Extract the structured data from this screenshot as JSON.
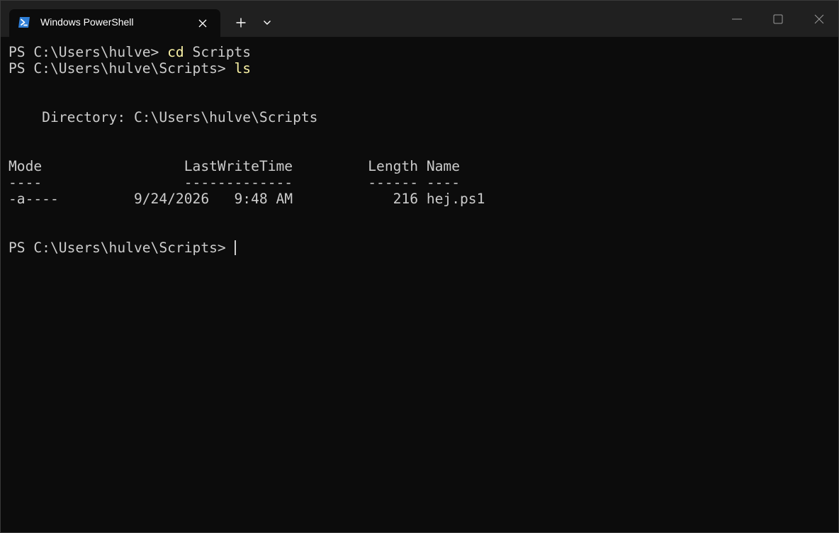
{
  "window": {
    "tab_title": "Windows PowerShell",
    "tab_icon": "powershell-icon",
    "new_tab_icon": "plus-icon",
    "dropdown_icon": "chevron-down-icon",
    "minimize_icon": "minimize-icon",
    "maximize_icon": "maximize-icon",
    "close_icon": "close-icon"
  },
  "colors": {
    "background": "#0c0c0c",
    "titlebar": "#202020",
    "text": "#cccccc",
    "command": "#f9f1a5"
  },
  "terminal": {
    "line1": {
      "prompt": "PS C:\\Users\\hulve> ",
      "command": "cd",
      "args": " Scripts"
    },
    "line2": {
      "prompt": "PS C:\\Users\\hulve\\Scripts> ",
      "command": "ls"
    },
    "directory_line": "    Directory: C:\\Users\\hulve\\Scripts",
    "header_line": "Mode                 LastWriteTime         Length Name",
    "separator_line": "----                 -------------         ------ ----",
    "rows": [
      {
        "text": "-a----         9/24/2026   9:48 AM            216 hej.ps1"
      }
    ],
    "final_prompt": "PS C:\\Users\\hulve\\Scripts> "
  }
}
